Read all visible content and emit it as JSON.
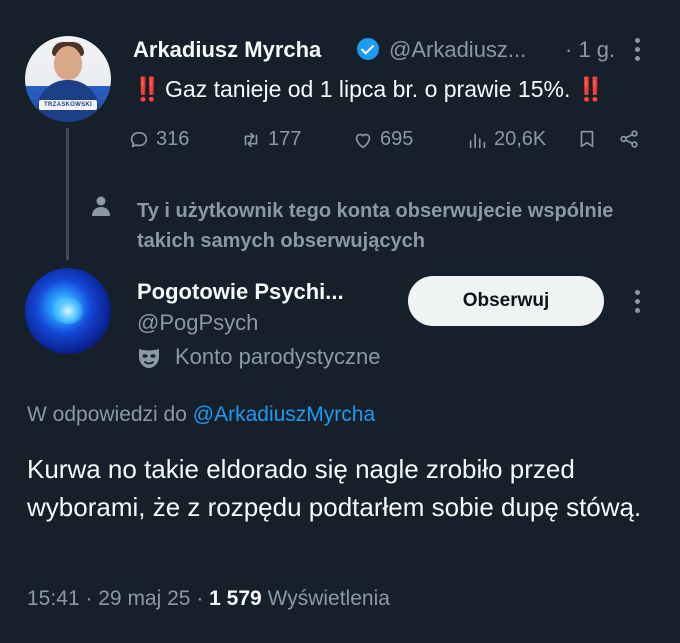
{
  "reply_context": {
    "author_name": "Arkadiusz Myrcha",
    "author_handle": "@Arkadiusz...",
    "time_ago": "· 1 g.",
    "text": "Gaz tanieje od 1 lipca br. o prawie 15%.",
    "emoji_marks": "‼️",
    "avatar_band_text": "TRZASKOWSKI",
    "stats": {
      "replies": "316",
      "reposts": "177",
      "likes": "695",
      "views": "20,6K"
    }
  },
  "notice": {
    "icon": "person-icon",
    "text": "Ty i użytkownik tego konta obserwujecie wspólnie takich samych obserwujących"
  },
  "tweet": {
    "author_name": "Pogotowie Psychi...",
    "author_handle": "@PogPsych",
    "follow_label": "Obserwuj",
    "account_label": "Konto parodystyczne",
    "replying_to_prefix": "W odpowiedzi do",
    "replying_to_handle": "@ArkadiuszMyrcha",
    "text": "Kurwa no takie eldorado się nagle zrobiło przed wyborami, że z rozpędu podtarłem sobie dupę stówą.",
    "time": "15:41",
    "date": "29 maj 25",
    "views_count": "1 579",
    "views_label": "Wyświetlenia"
  },
  "colors": {
    "background": "#15202b",
    "text": "#f7f9f9",
    "muted": "#8b98a5",
    "accent": "#1d9bf0",
    "emoji_red": "#e0245e"
  }
}
